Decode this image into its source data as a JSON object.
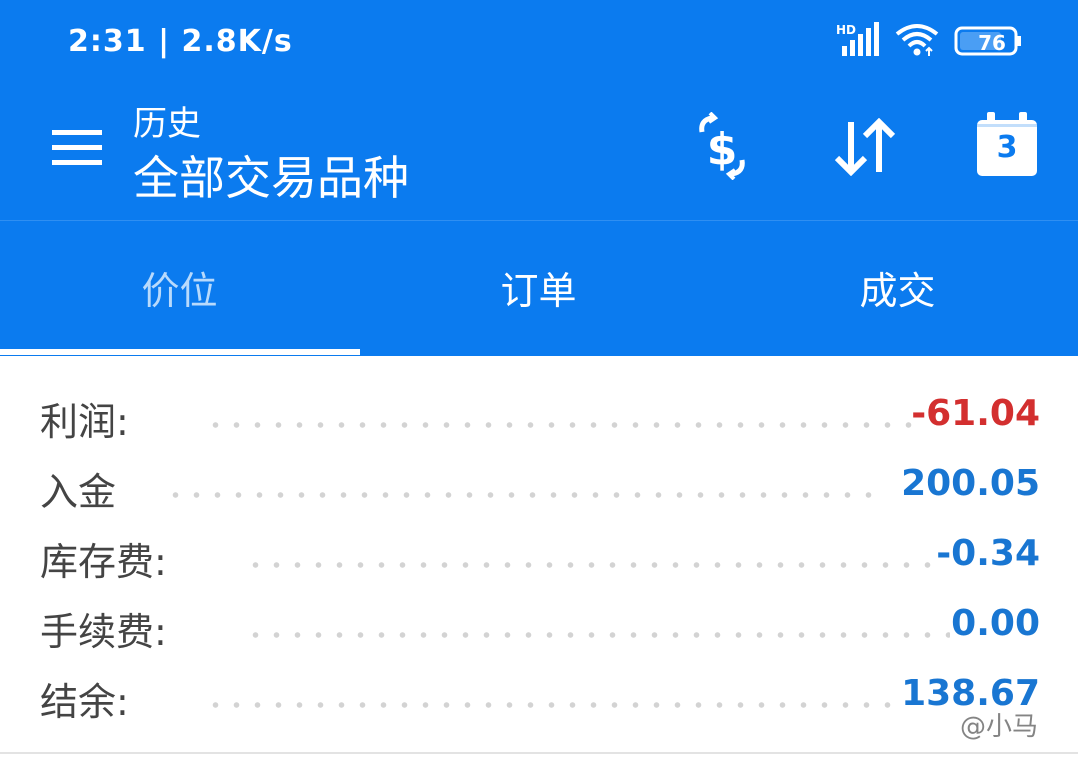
{
  "status_bar": {
    "time_speed": "2:31 | 2.8K/s",
    "network_label": "HD",
    "battery": "76",
    "icons": [
      "hd-signal-icon",
      "wifi-icon",
      "battery-icon"
    ]
  },
  "toolbar": {
    "subtitle": "历史",
    "title": "全部交易品种",
    "icons": [
      "menu-icon",
      "currency-exchange-icon",
      "sort-icon",
      "calendar-icon"
    ],
    "calendar_day": "3"
  },
  "tabs": [
    {
      "label": "价位",
      "active": true
    },
    {
      "label": "订单",
      "active": false
    },
    {
      "label": "成交",
      "active": false
    }
  ],
  "summary": [
    {
      "label": "利润:",
      "value": "-61.04",
      "color": "#d32f2f"
    },
    {
      "label": "入金",
      "value": "200.05",
      "color": "#1976d2"
    },
    {
      "label": "库存费:",
      "value": "-0.34",
      "color": "#1976d2"
    },
    {
      "label": "手续费:",
      "value": "0.00",
      "color": "#1976d2"
    },
    {
      "label": "结余:",
      "value": "138.67",
      "color": "#1976d2"
    }
  ],
  "watermark": "@小马",
  "colors": {
    "appbar": "#0b7bef",
    "negative": "#d32f2f",
    "positive": "#1976d2"
  }
}
